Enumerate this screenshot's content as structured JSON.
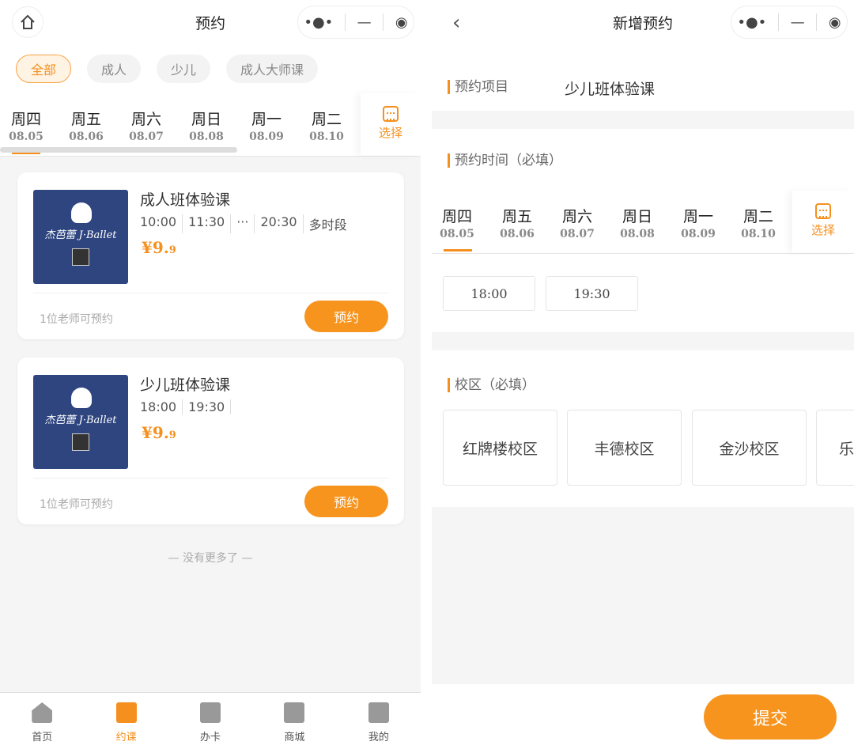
{
  "left": {
    "title": "预约",
    "capsule": {
      "more": "•●•",
      "minimize": "—",
      "close": "◉"
    },
    "filters": [
      "全部",
      "成人",
      "少儿",
      "成人大师课"
    ],
    "days": [
      {
        "w": "周四",
        "d": "08.05"
      },
      {
        "w": "周五",
        "d": "08.06"
      },
      {
        "w": "周六",
        "d": "08.07"
      },
      {
        "w": "周日",
        "d": "08.08"
      },
      {
        "w": "周一",
        "d": "08.09"
      },
      {
        "w": "周二",
        "d": "08.10"
      }
    ],
    "pick_label": "选择",
    "cards": [
      {
        "title": "成人班体验课",
        "times": [
          "10:00",
          "11:30",
          "···",
          "20:30",
          "多时段"
        ],
        "price_int": "¥9.",
        "price_dec": "9",
        "teachers": "1位老师可预约",
        "button": "预约",
        "logo": "杰芭蕾 J·Ballet"
      },
      {
        "title": "少儿班体验课",
        "times": [
          "18:00",
          "19:30"
        ],
        "price_int": "¥9.",
        "price_dec": "9",
        "teachers": "1位老师可预约",
        "button": "预约",
        "logo": "杰芭蕾 J·Ballet"
      }
    ],
    "no_more": "— 没有更多了 —",
    "tabs": [
      "首页",
      "约课",
      "办卡",
      "商城",
      "我的"
    ]
  },
  "right": {
    "title": "新增预约",
    "project_label": "预约项目",
    "project_value": "少儿班体验课",
    "time_label": "预约时间（必填）",
    "days": [
      {
        "w": "周四",
        "d": "08.05"
      },
      {
        "w": "周五",
        "d": "08.06"
      },
      {
        "w": "周六",
        "d": "08.07"
      },
      {
        "w": "周日",
        "d": "08.08"
      },
      {
        "w": "周一",
        "d": "08.09"
      },
      {
        "w": "周二",
        "d": "08.10"
      }
    ],
    "pick_label": "选择",
    "slots": [
      "18:00",
      "19:30"
    ],
    "campus_label": "校区（必填）",
    "campuses": [
      "红牌楼校区",
      "丰德校区",
      "金沙校区",
      "乐"
    ],
    "submit": "提交"
  },
  "colors": {
    "accent": "#f7941d"
  }
}
